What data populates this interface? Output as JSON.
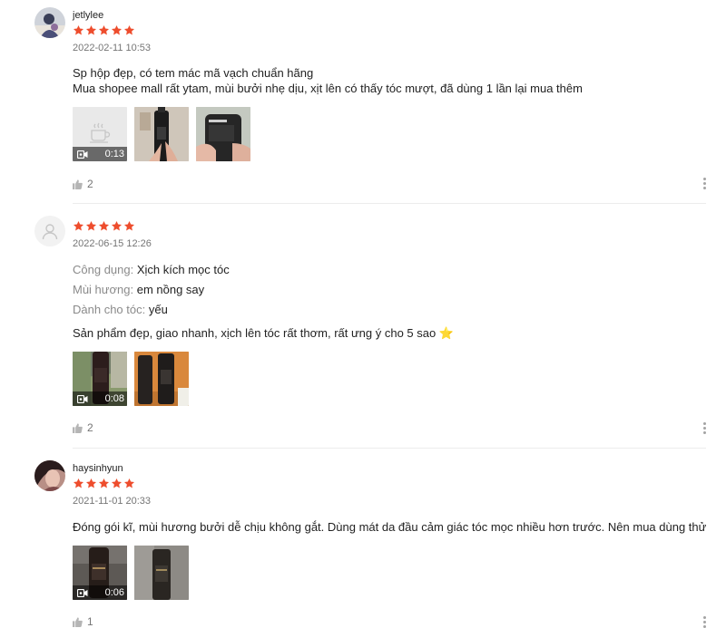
{
  "colors": {
    "star": "#ee4d2d",
    "muted": "#757575",
    "divider": "#ececec"
  },
  "reviews": [
    {
      "username": "jetlylee",
      "rating": 5,
      "time": "2022-02-11 10:53",
      "attributes": [],
      "text_lines": [
        "Sp hộp đẹp, có tem mác mã vạch chuẩn hãng",
        "Mua shopee mall rất ytam, mùi bưởi nhẹ dịu, xịt lên có thấy tóc mượt, đã dùng 1 lần lại mua thêm"
      ],
      "video_duration": "0:13",
      "likes": "2"
    },
    {
      "username": "",
      "rating": 5,
      "time": "2022-06-15 12:26",
      "attributes": [
        {
          "label": "Công dụng:",
          "value": "Xịch kích mọc tóc"
        },
        {
          "label": "Mùi hương:",
          "value": "em nồng say"
        },
        {
          "label": "Dành cho tóc:",
          "value": "yếu"
        }
      ],
      "text_lines": [
        "Sản phẩm đẹp, giao nhanh, xịch lên tóc rất thơm, rất ưng ý cho 5 sao ⭐"
      ],
      "video_duration": "0:08",
      "likes": "2"
    },
    {
      "username": "haysinhyun",
      "rating": 5,
      "time": "2021-11-01 20:33",
      "attributes": [],
      "text_lines": [
        "Đóng gói kĩ, mùi hương bưởi dễ chịu không gắt. Dùng mát da đầu cảm giác tóc mọc nhiều hơn trước. Nên mua dùng thử"
      ],
      "video_duration": "0:06",
      "likes": "1"
    }
  ]
}
